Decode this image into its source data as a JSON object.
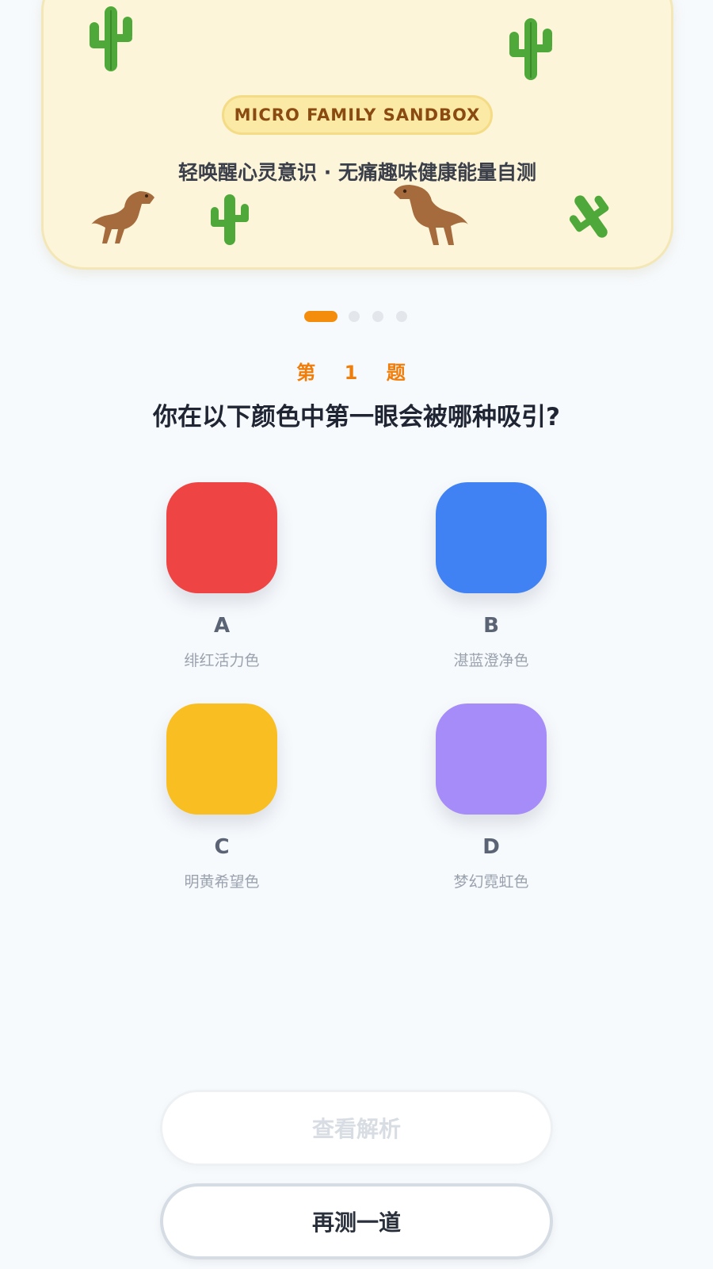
{
  "banner": {
    "badge": "MICRO FAMILY SANDBOX",
    "tagline": "轻唤醒心灵意识 · 无痛趣味健康能量自测"
  },
  "question": {
    "number_label": "第 1 题",
    "text": "你在以下颜色中第一眼会被哪种吸引?",
    "options": [
      {
        "letter": "A",
        "label": "绯红活力色",
        "color": "#ee4444"
      },
      {
        "letter": "B",
        "label": "湛蓝澄净色",
        "color": "#4082f3"
      },
      {
        "letter": "C",
        "label": "明黄希望色",
        "color": "#f9bf22"
      },
      {
        "letter": "D",
        "label": "梦幻霓虹色",
        "color": "#a68cf8"
      }
    ]
  },
  "pager": {
    "total": 4,
    "current": 1
  },
  "buttons": {
    "analysis": "查看解析",
    "retry": "再测一道"
  },
  "colors": {
    "accent": "#f58d0c",
    "banner_bg": "#fdf5d9",
    "cactus": "#4fa83a",
    "dino": "#a56b3d"
  },
  "icons": [
    "cactus-icon",
    "dinosaur-icon"
  ]
}
